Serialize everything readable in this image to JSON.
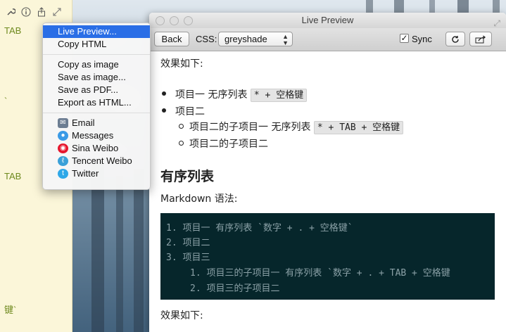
{
  "editor": {
    "lines": [
      "TAB",
      "`",
      "TAB",
      "键`"
    ]
  },
  "menu": {
    "items": [
      {
        "label": "Live Preview...",
        "selected": true
      },
      {
        "label": "Copy HTML"
      },
      {
        "label": "Copy as image"
      },
      {
        "label": "Save as image..."
      },
      {
        "label": "Save as PDF..."
      },
      {
        "label": "Export as HTML..."
      }
    ],
    "share_items": [
      {
        "label": "Email",
        "icon": "email-icon"
      },
      {
        "label": "Messages",
        "icon": "messages-icon"
      },
      {
        "label": "Sina Weibo",
        "icon": "sina-weibo-icon"
      },
      {
        "label": "Tencent Weibo",
        "icon": "tencent-weibo-icon"
      },
      {
        "label": "Twitter",
        "icon": "twitter-icon"
      }
    ]
  },
  "window": {
    "title": "Live Preview",
    "back_label": "Back",
    "css_label": "CSS:",
    "css_value": "greyshade",
    "sync_label": "Sync",
    "sync_checked": true
  },
  "preview": {
    "effect_label": "效果如下:",
    "ul": [
      {
        "text": "项目一 无序列表",
        "code": "* + 空格键"
      },
      {
        "text": "项目二",
        "code": ""
      }
    ],
    "ul_sub": [
      {
        "text": "项目二的子项目一 无序列表",
        "code": "* + TAB + 空格键"
      },
      {
        "text": "项目二的子项目二",
        "code": ""
      }
    ],
    "ordered_heading": "有序列表",
    "syntax_label": "Markdown 语法:",
    "code_lines": [
      "1. 项目一 有序列表 `数字 + . + 空格键`",
      "2. 项目二",
      "3. 项目三",
      "1. 项目三的子项目一 有序列表 `数字 + . + TAB + 空格键",
      "2. 项目三的子项目二"
    ],
    "effect_label_bottom": "效果如下:"
  },
  "colors": {
    "accent": "#2a6ee6",
    "code_bg": "#06262b",
    "editor_bg": "#fbf6d9",
    "editor_text": "#6f8a1f"
  }
}
